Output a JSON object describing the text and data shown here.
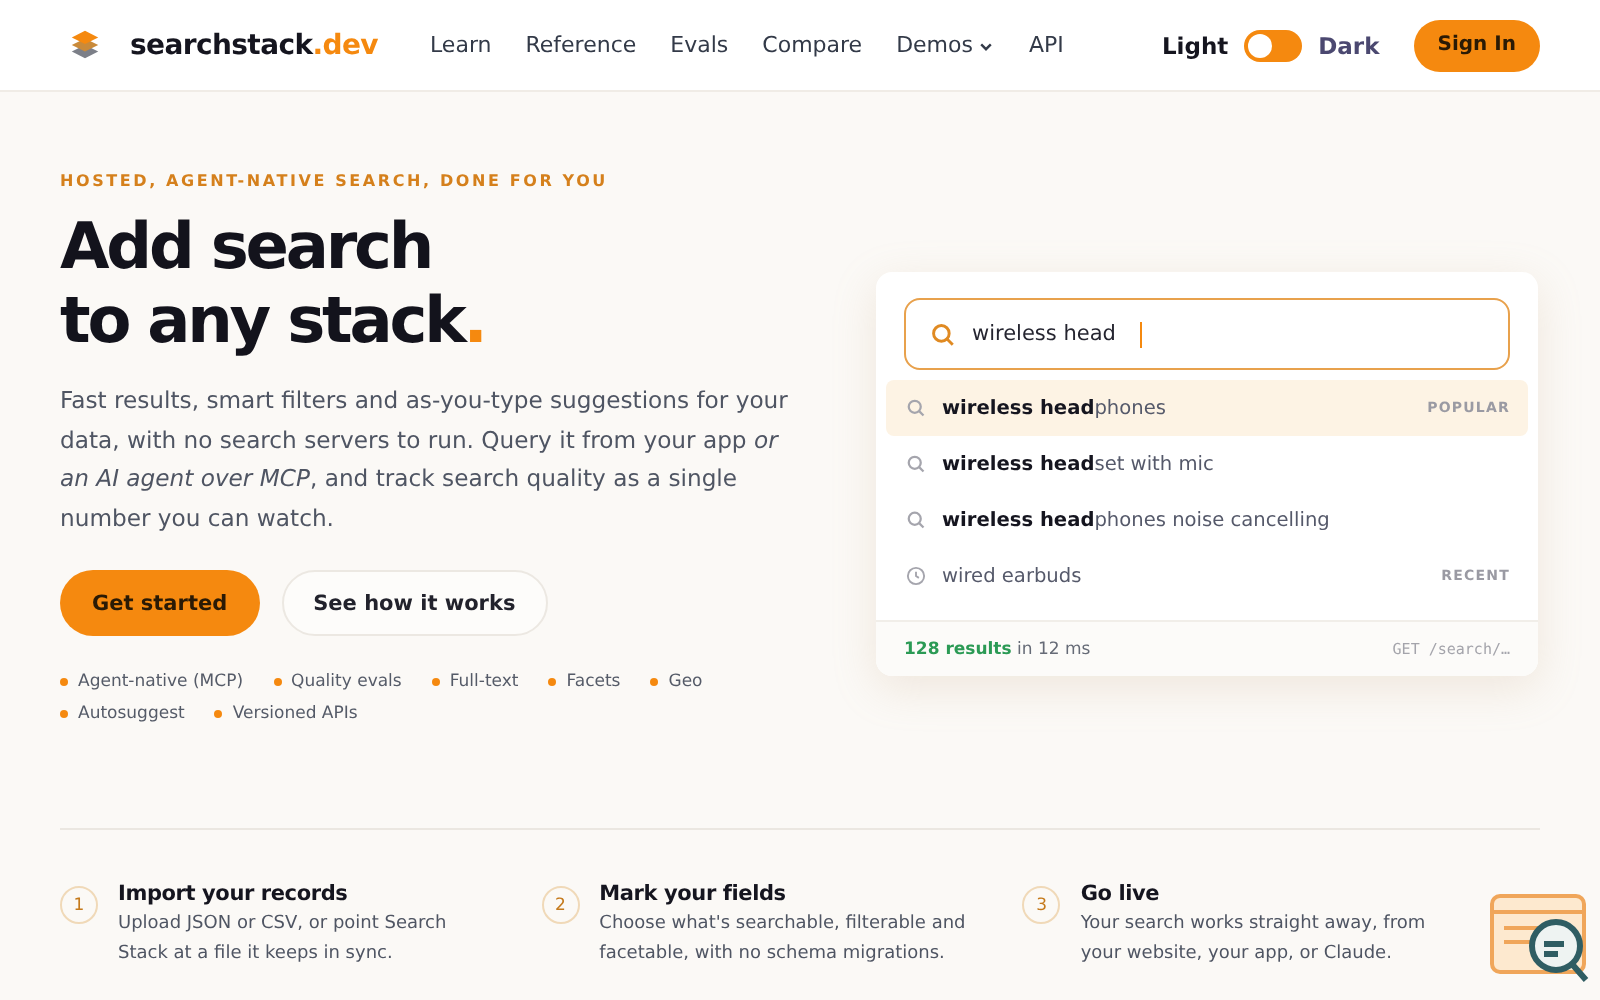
{
  "brand": {
    "name": "searchstack",
    "tld": ".dev"
  },
  "nav": [
    {
      "label": "Learn",
      "has_menu": false
    },
    {
      "label": "Reference",
      "has_menu": false
    },
    {
      "label": "Evals",
      "has_menu": false
    },
    {
      "label": "Compare",
      "has_menu": false
    },
    {
      "label": "Demos",
      "has_menu": true
    },
    {
      "label": "API",
      "has_menu": false
    }
  ],
  "theme_toggle": {
    "light_label": "Light",
    "dark_label": "Dark",
    "on": false
  },
  "sign_in": "Sign In",
  "hero": {
    "eyebrow": "HOSTED, AGENT-NATIVE SEARCH, DONE FOR YOU",
    "title_lines": [
      "Add search",
      "to any stack"
    ],
    "title_dot": ".",
    "lede": "Fast results, smart filters and as-you-type suggestions for your data, with no search servers to run. Query it from your app *or an AI agent over MCP*, and track search quality as a single number you can watch.",
    "primary": "Get started",
    "secondary": "See how it works",
    "features": [
      "Agent-native (MCP)",
      "Quality evals",
      "Full-text",
      "Facets",
      "Geo",
      "Autosuggest",
      "Versioned APIs"
    ]
  },
  "demo": {
    "query": "wireless head",
    "suggestions": [
      {
        "kind": "search",
        "text": "**wireless head**phones",
        "badge": "POPULAR",
        "selected": true
      },
      {
        "kind": "search",
        "text": "**wireless head**set with mic",
        "selected": false
      },
      {
        "kind": "search",
        "text": "**wireless head**phones noise cancelling",
        "selected": false
      },
      {
        "kind": "recent",
        "text": "wired earbuds",
        "badge": "RECENT",
        "selected": false
      }
    ],
    "results_count": "128 results",
    "results_time": "in 12 ms",
    "endpoint": "GET /search/…"
  },
  "steps": [
    {
      "number": "1",
      "title": "Import your records",
      "text": "Upload JSON or CSV, or point Search Stack at a file it keeps in sync."
    },
    {
      "number": "2",
      "title": "Mark your fields",
      "text": "Choose what's searchable, filterable and facetable, with no schema migrations."
    },
    {
      "number": "3",
      "title": "Go live",
      "text": "Your search works straight away, from your website, your app, or Claude."
    }
  ]
}
